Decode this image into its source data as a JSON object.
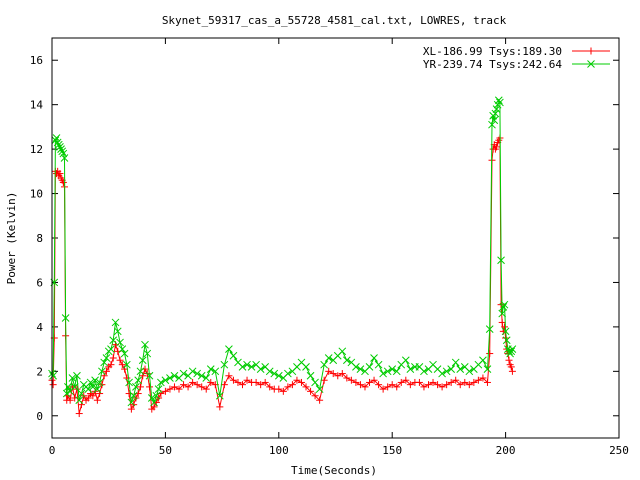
{
  "chart_data": {
    "type": "line",
    "title": "Skynet_59317_cas_a_55728_4581_cal.txt, LOWRES, track",
    "xlabel": "Time(Seconds)",
    "ylabel": "Power (Kelvin)",
    "xlim": [
      0,
      250
    ],
    "ylim": [
      -1,
      17
    ],
    "xticks": [
      0,
      50,
      100,
      150,
      200,
      250
    ],
    "yticks": [
      0,
      2,
      4,
      6,
      8,
      10,
      12,
      14,
      16
    ],
    "grid": false,
    "legend_position": "top-right",
    "series": [
      {
        "name": "XL-186.99 Tsys:189.30",
        "color": "#ff0000",
        "marker": "plus",
        "points": [
          [
            0,
            1.6
          ],
          [
            0.5,
            1.4
          ],
          [
            1,
            3.5
          ],
          [
            1.5,
            11.0
          ],
          [
            2,
            10.9
          ],
          [
            2.5,
            11.0
          ],
          [
            3,
            10.8
          ],
          [
            3.5,
            10.9
          ],
          [
            4,
            10.7
          ],
          [
            4.5,
            10.6
          ],
          [
            5,
            10.5
          ],
          [
            5.5,
            10.3
          ],
          [
            6,
            3.6
          ],
          [
            6.5,
            0.7
          ],
          [
            7,
            0.9
          ],
          [
            8,
            0.7
          ],
          [
            9,
            1.3
          ],
          [
            10,
            0.8
          ],
          [
            11,
            1.2
          ],
          [
            12,
            0.1
          ],
          [
            13,
            0.5
          ],
          [
            14,
            0.9
          ],
          [
            15,
            0.7
          ],
          [
            16,
            0.8
          ],
          [
            17,
            1.0
          ],
          [
            18,
            0.9
          ],
          [
            19,
            1.1
          ],
          [
            20,
            0.7
          ],
          [
            21,
            1.0
          ],
          [
            22,
            1.4
          ],
          [
            23,
            1.8
          ],
          [
            24,
            2.0
          ],
          [
            25,
            2.2
          ],
          [
            26,
            2.3
          ],
          [
            27,
            2.6
          ],
          [
            28,
            3.2
          ],
          [
            29,
            2.9
          ],
          [
            30,
            2.5
          ],
          [
            31,
            2.3
          ],
          [
            32,
            2.1
          ],
          [
            33,
            1.7
          ],
          [
            34,
            1.0
          ],
          [
            35,
            0.3
          ],
          [
            36,
            0.5
          ],
          [
            37,
            0.8
          ],
          [
            38,
            1.0
          ],
          [
            39,
            1.3
          ],
          [
            40,
            1.8
          ],
          [
            41,
            2.1
          ],
          [
            42,
            1.9
          ],
          [
            43,
            1.3
          ],
          [
            44,
            0.3
          ],
          [
            45,
            0.4
          ],
          [
            46,
            0.6
          ],
          [
            47,
            0.8
          ],
          [
            48,
            1.0
          ],
          [
            50,
            1.1
          ],
          [
            52,
            1.2
          ],
          [
            54,
            1.3
          ],
          [
            56,
            1.2
          ],
          [
            58,
            1.4
          ],
          [
            60,
            1.3
          ],
          [
            62,
            1.5
          ],
          [
            64,
            1.4
          ],
          [
            66,
            1.3
          ],
          [
            68,
            1.2
          ],
          [
            70,
            1.5
          ],
          [
            72,
            1.4
          ],
          [
            74,
            0.4
          ],
          [
            76,
            1.4
          ],
          [
            78,
            1.8
          ],
          [
            80,
            1.6
          ],
          [
            82,
            1.5
          ],
          [
            84,
            1.4
          ],
          [
            86,
            1.6
          ],
          [
            88,
            1.5
          ],
          [
            90,
            1.5
          ],
          [
            92,
            1.4
          ],
          [
            94,
            1.5
          ],
          [
            96,
            1.3
          ],
          [
            98,
            1.2
          ],
          [
            100,
            1.2
          ],
          [
            102,
            1.1
          ],
          [
            104,
            1.3
          ],
          [
            106,
            1.4
          ],
          [
            108,
            1.6
          ],
          [
            110,
            1.5
          ],
          [
            112,
            1.3
          ],
          [
            114,
            1.1
          ],
          [
            116,
            0.9
          ],
          [
            118,
            0.7
          ],
          [
            120,
            1.6
          ],
          [
            122,
            2.0
          ],
          [
            124,
            1.9
          ],
          [
            126,
            1.8
          ],
          [
            128,
            1.9
          ],
          [
            130,
            1.7
          ],
          [
            132,
            1.6
          ],
          [
            134,
            1.5
          ],
          [
            136,
            1.4
          ],
          [
            138,
            1.3
          ],
          [
            140,
            1.5
          ],
          [
            142,
            1.6
          ],
          [
            144,
            1.4
          ],
          [
            146,
            1.2
          ],
          [
            148,
            1.3
          ],
          [
            150,
            1.4
          ],
          [
            152,
            1.3
          ],
          [
            154,
            1.5
          ],
          [
            156,
            1.6
          ],
          [
            158,
            1.4
          ],
          [
            160,
            1.5
          ],
          [
            162,
            1.5
          ],
          [
            164,
            1.3
          ],
          [
            166,
            1.4
          ],
          [
            168,
            1.5
          ],
          [
            170,
            1.4
          ],
          [
            172,
            1.3
          ],
          [
            174,
            1.4
          ],
          [
            176,
            1.5
          ],
          [
            178,
            1.6
          ],
          [
            180,
            1.4
          ],
          [
            182,
            1.5
          ],
          [
            184,
            1.4
          ],
          [
            186,
            1.5
          ],
          [
            188,
            1.6
          ],
          [
            190,
            1.7
          ],
          [
            192,
            1.5
          ],
          [
            193,
            2.8
          ],
          [
            194,
            11.5
          ],
          [
            194.5,
            12.0
          ],
          [
            195,
            12.2
          ],
          [
            195.5,
            12.0
          ],
          [
            196,
            12.1
          ],
          [
            196.5,
            12.3
          ],
          [
            197,
            12.4
          ],
          [
            197.5,
            12.5
          ],
          [
            198,
            5.0
          ],
          [
            198.5,
            4.2
          ],
          [
            199,
            3.8
          ],
          [
            199.5,
            4.0
          ],
          [
            200,
            3.5
          ],
          [
            200.5,
            3.0
          ],
          [
            201,
            2.8
          ],
          [
            201.5,
            2.5
          ],
          [
            202,
            2.3
          ],
          [
            202.5,
            2.2
          ],
          [
            203,
            2.0
          ]
        ]
      },
      {
        "name": "YR-239.74 Tsys:242.64",
        "color": "#00cc00",
        "marker": "cross",
        "points": [
          [
            0,
            1.9
          ],
          [
            0.5,
            1.8
          ],
          [
            1,
            6.0
          ],
          [
            1.5,
            12.4
          ],
          [
            2,
            12.5
          ],
          [
            2.5,
            12.3
          ],
          [
            3,
            12.2
          ],
          [
            3.5,
            12.1
          ],
          [
            4,
            12.0
          ],
          [
            4.5,
            11.9
          ],
          [
            5,
            11.8
          ],
          [
            5.5,
            11.6
          ],
          [
            6,
            4.4
          ],
          [
            6.5,
            1.0
          ],
          [
            7,
            1.3
          ],
          [
            8,
            1.1
          ],
          [
            9,
            1.7
          ],
          [
            10,
            1.3
          ],
          [
            11,
            1.8
          ],
          [
            12,
            0.7
          ],
          [
            13,
            1.0
          ],
          [
            14,
            1.4
          ],
          [
            15,
            1.3
          ],
          [
            16,
            1.2
          ],
          [
            17,
            1.5
          ],
          [
            18,
            1.3
          ],
          [
            19,
            1.6
          ],
          [
            20,
            1.2
          ],
          [
            21,
            1.5
          ],
          [
            22,
            2.0
          ],
          [
            23,
            2.4
          ],
          [
            24,
            2.6
          ],
          [
            25,
            2.9
          ],
          [
            26,
            3.0
          ],
          [
            27,
            3.4
          ],
          [
            28,
            4.2
          ],
          [
            29,
            3.8
          ],
          [
            30,
            3.3
          ],
          [
            31,
            3.0
          ],
          [
            32,
            2.8
          ],
          [
            33,
            2.3
          ],
          [
            34,
            1.5
          ],
          [
            35,
            0.6
          ],
          [
            36,
            0.9
          ],
          [
            37,
            1.3
          ],
          [
            38,
            1.6
          ],
          [
            39,
            2.0
          ],
          [
            40,
            2.5
          ],
          [
            41,
            3.2
          ],
          [
            42,
            2.8
          ],
          [
            43,
            1.8
          ],
          [
            44,
            0.8
          ],
          [
            45,
            0.6
          ],
          [
            46,
            0.9
          ],
          [
            47,
            1.2
          ],
          [
            48,
            1.5
          ],
          [
            50,
            1.6
          ],
          [
            52,
            1.7
          ],
          [
            54,
            1.8
          ],
          [
            56,
            1.7
          ],
          [
            58,
            1.9
          ],
          [
            60,
            1.8
          ],
          [
            62,
            2.0
          ],
          [
            64,
            1.9
          ],
          [
            66,
            1.8
          ],
          [
            68,
            1.7
          ],
          [
            70,
            2.1
          ],
          [
            72,
            2.0
          ],
          [
            74,
            0.9
          ],
          [
            76,
            2.3
          ],
          [
            78,
            3.0
          ],
          [
            80,
            2.7
          ],
          [
            82,
            2.4
          ],
          [
            84,
            2.2
          ],
          [
            86,
            2.3
          ],
          [
            88,
            2.2
          ],
          [
            90,
            2.3
          ],
          [
            92,
            2.1
          ],
          [
            94,
            2.2
          ],
          [
            96,
            2.0
          ],
          [
            98,
            1.9
          ],
          [
            100,
            1.8
          ],
          [
            102,
            1.7
          ],
          [
            104,
            1.9
          ],
          [
            106,
            2.0
          ],
          [
            108,
            2.2
          ],
          [
            110,
            2.4
          ],
          [
            112,
            2.2
          ],
          [
            114,
            1.8
          ],
          [
            116,
            1.5
          ],
          [
            118,
            1.2
          ],
          [
            120,
            2.3
          ],
          [
            122,
            2.6
          ],
          [
            124,
            2.5
          ],
          [
            126,
            2.7
          ],
          [
            128,
            2.9
          ],
          [
            130,
            2.5
          ],
          [
            132,
            2.4
          ],
          [
            134,
            2.2
          ],
          [
            136,
            2.1
          ],
          [
            138,
            2.0
          ],
          [
            140,
            2.2
          ],
          [
            142,
            2.6
          ],
          [
            144,
            2.3
          ],
          [
            146,
            1.9
          ],
          [
            148,
            2.0
          ],
          [
            150,
            2.1
          ],
          [
            152,
            2.0
          ],
          [
            154,
            2.3
          ],
          [
            156,
            2.5
          ],
          [
            158,
            2.1
          ],
          [
            160,
            2.2
          ],
          [
            162,
            2.2
          ],
          [
            164,
            2.0
          ],
          [
            166,
            2.1
          ],
          [
            168,
            2.3
          ],
          [
            170,
            2.1
          ],
          [
            172,
            1.9
          ],
          [
            174,
            2.0
          ],
          [
            176,
            2.1
          ],
          [
            178,
            2.4
          ],
          [
            180,
            2.1
          ],
          [
            182,
            2.2
          ],
          [
            184,
            2.0
          ],
          [
            186,
            2.1
          ],
          [
            188,
            2.3
          ],
          [
            190,
            2.5
          ],
          [
            192,
            2.1
          ],
          [
            193,
            3.9
          ],
          [
            194,
            13.1
          ],
          [
            194.5,
            13.5
          ],
          [
            195,
            13.3
          ],
          [
            195.5,
            13.6
          ],
          [
            196,
            13.8
          ],
          [
            196.5,
            14.0
          ],
          [
            197,
            14.2
          ],
          [
            197.5,
            14.1
          ],
          [
            198,
            7.0
          ],
          [
            198.5,
            4.6
          ],
          [
            199,
            4.9
          ],
          [
            199.5,
            5.0
          ],
          [
            200,
            3.8
          ],
          [
            200.5,
            3.4
          ],
          [
            201,
            3.0
          ],
          [
            201.5,
            2.9
          ],
          [
            202,
            2.8
          ],
          [
            202.5,
            2.9
          ],
          [
            203,
            3.0
          ]
        ]
      }
    ]
  }
}
